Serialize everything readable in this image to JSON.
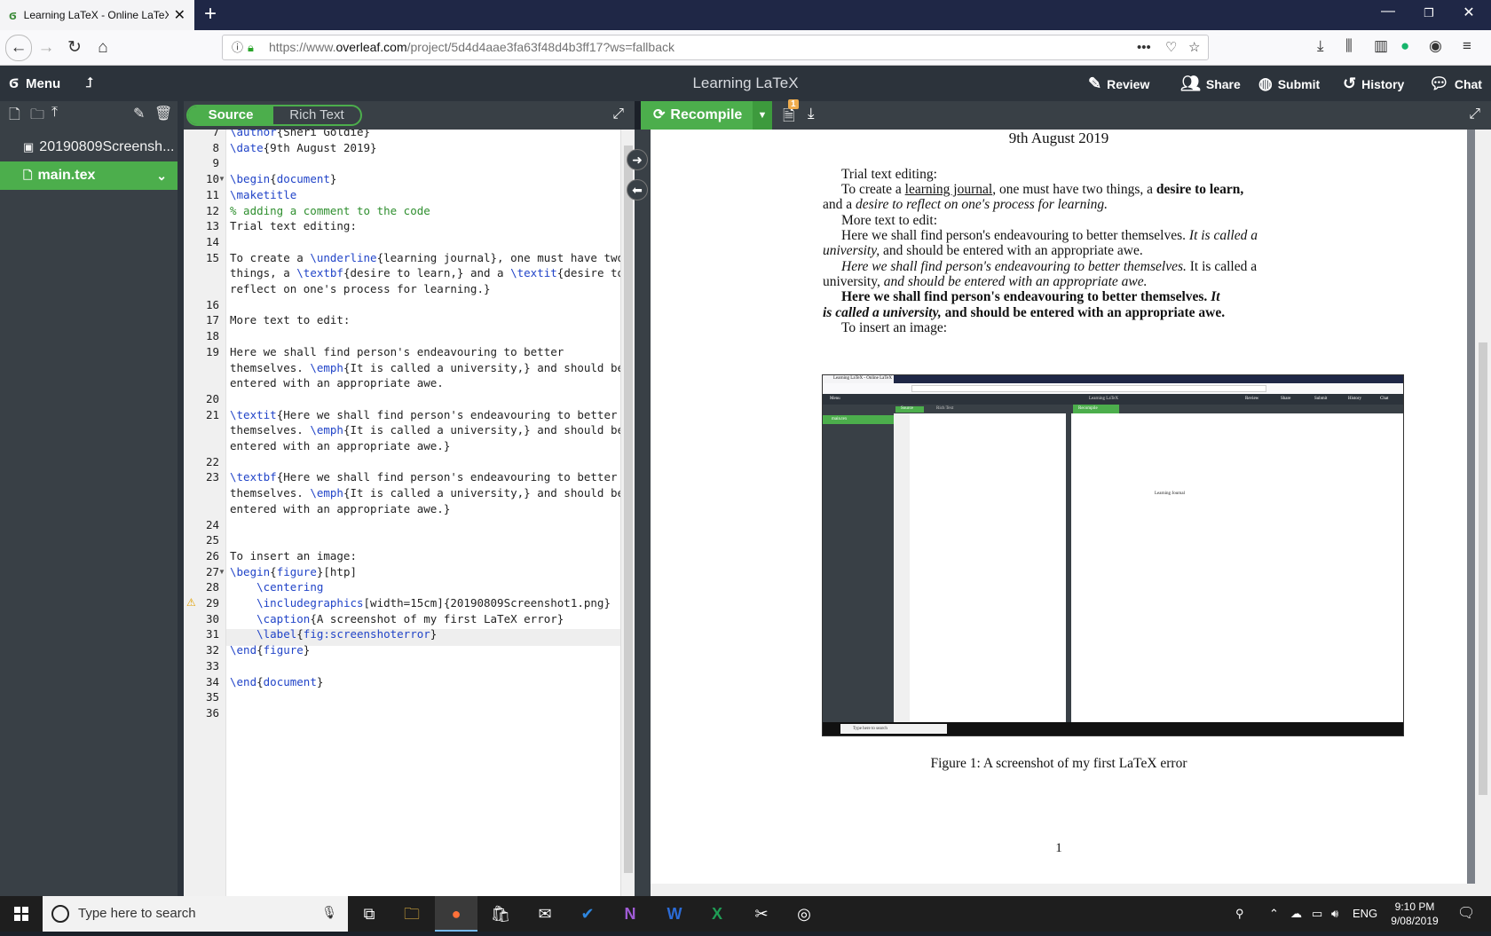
{
  "browser": {
    "tab_title": "Learning LaTeX - Online LaTeX",
    "url_prefix": "https://www.",
    "url_domain": "overleaf.com",
    "url_rest": "/project/5d4d4aae3fa63f48d4b3ff17?ws=fallback",
    "more": "•••"
  },
  "header": {
    "menu_label": "Menu",
    "project_title": "Learning LaTeX",
    "review": "Review",
    "share": "Share",
    "submit": "Submit",
    "history": "History",
    "chat": "Chat"
  },
  "toolbar": {
    "source": "Source",
    "rich_text": "Rich Text",
    "recompile": "Recompile",
    "logs_badge": "1"
  },
  "file_tree": {
    "items": [
      {
        "name": "20190809Screensh...",
        "icon": "image-file-icon",
        "selected": false
      },
      {
        "name": "main.tex",
        "icon": "file-icon",
        "selected": true
      }
    ]
  },
  "editor": {
    "lines": [
      {
        "n": "7",
        "text": "\\author{Sheri Goldie}"
      },
      {
        "n": "8",
        "text": "\\date{9th August 2019}"
      },
      {
        "n": "9",
        "text": ""
      },
      {
        "n": "10",
        "text": "\\begin{document}"
      },
      {
        "n": "11",
        "text": "\\maketitle"
      },
      {
        "n": "12",
        "text": "% adding a comment to the code"
      },
      {
        "n": "13",
        "text": "Trial text editing:"
      },
      {
        "n": "14",
        "text": ""
      },
      {
        "n": "15",
        "text": "To create a \\underline{learning journal}, one must have two"
      },
      {
        "n": "",
        "text": "things, a \\textbf{desire to learn,} and a \\textit{desire to"
      },
      {
        "n": "",
        "text": "reflect on one's process for learning.}"
      },
      {
        "n": "16",
        "text": ""
      },
      {
        "n": "17",
        "text": "More text to edit:"
      },
      {
        "n": "18",
        "text": ""
      },
      {
        "n": "19",
        "text": "Here we shall find person's endeavouring to better"
      },
      {
        "n": "",
        "text": "themselves. \\emph{It is called a university,} and should be"
      },
      {
        "n": "",
        "text": "entered with an appropriate awe."
      },
      {
        "n": "20",
        "text": ""
      },
      {
        "n": "21",
        "text": "\\textit{Here we shall find person's endeavouring to better"
      },
      {
        "n": "",
        "text": "themselves. \\emph{It is called a university,} and should be"
      },
      {
        "n": "",
        "text": "entered with an appropriate awe.}"
      },
      {
        "n": "22",
        "text": ""
      },
      {
        "n": "23",
        "text": "\\textbf{Here we shall find person's endeavouring to better"
      },
      {
        "n": "",
        "text": "themselves. \\emph{It is called a university,} and should be"
      },
      {
        "n": "",
        "text": "entered with an appropriate awe.}"
      },
      {
        "n": "24",
        "text": ""
      },
      {
        "n": "25",
        "text": ""
      },
      {
        "n": "26",
        "text": "To insert an image:"
      },
      {
        "n": "27",
        "text": "\\begin{figure}[htp]"
      },
      {
        "n": "28",
        "text": "    \\centering"
      },
      {
        "n": "29",
        "text": "    \\includegraphics[width=15cm]{20190809Screenshot1.png}"
      },
      {
        "n": "30",
        "text": "    \\caption{A screenshot of my first LaTeX error}"
      },
      {
        "n": "31",
        "text": "    \\label{fig:screenshoterror}"
      },
      {
        "n": "32",
        "text": "\\end{figure}"
      },
      {
        "n": "33",
        "text": ""
      },
      {
        "n": "34",
        "text": "\\end{document}"
      },
      {
        "n": "35",
        "text": ""
      },
      {
        "n": "36",
        "text": ""
      }
    ]
  },
  "pdf": {
    "date": "9th August 2019",
    "l1": "Trial text editing:",
    "l2a": "To create a ",
    "l2b": "learning journal",
    "l2c": ", one must have two things, a ",
    "l2d": "desire to learn,",
    "l3a": "and a ",
    "l3b": "desire to reflect on one's process for learning.",
    "l4": "More text to edit:",
    "l5a": "Here we shall find person's endeavouring to better themselves. ",
    "l5b": "It is called a",
    "l6a": "university,",
    "l6b": " and should be entered with an appropriate awe.",
    "l7a": "Here we shall find person's endeavouring to better themselves.",
    "l7b": " It is called a",
    "l8a": "university,",
    "l8b": " and should be entered with an appropriate awe.",
    "l9a": "Here we shall find person's endeavouring to better themselves. ",
    "l9b": "It",
    "l10a": "is called a university,",
    "l10b": " and should be entered with an appropriate awe.",
    "l11": "To insert an image:",
    "caption": "Figure 1: A screenshot of my first LaTeX error",
    "page_number": "1",
    "mini": {
      "tab": "Learning LaTeX - Online LaTeX",
      "title": "Learning LaTeX",
      "source": "Source",
      "rich": "Rich Text",
      "recompile": "Recompile",
      "file": "main.tex",
      "review": "Review",
      "share": "Share",
      "submit": "Submit",
      "history": "History",
      "chat": "Chat",
      "menu": "Menu",
      "page_text": "Learning Journal",
      "search": "Type here to search"
    }
  },
  "taskbar": {
    "search_placeholder": "Type here to search",
    "lang": "ENG",
    "time": "9:10 PM",
    "date": "9/08/2019"
  },
  "colors": {
    "overleaf_green": "#4cae4c",
    "dark_panel": "#394046",
    "header": "#2c333b"
  }
}
